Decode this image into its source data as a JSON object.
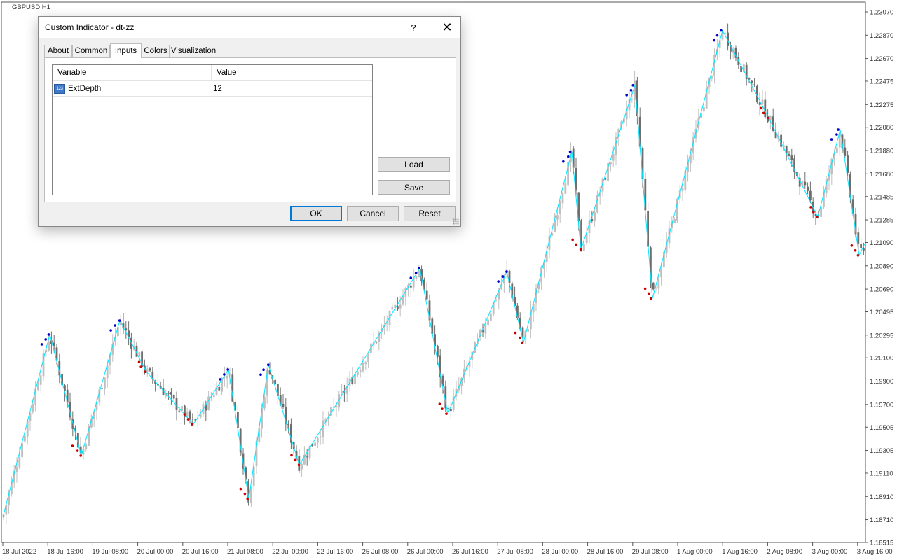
{
  "chart": {
    "symbol_label": "GBPUSD,H1",
    "price_labels": [
      "1.23070",
      "1.22870",
      "1.22670",
      "1.22475",
      "1.22275",
      "1.22080",
      "1.21880",
      "1.21680",
      "1.21485",
      "1.21285",
      "1.21090",
      "1.20890",
      "1.20690",
      "1.20495",
      "1.20295",
      "1.20100",
      "1.19900",
      "1.19700",
      "1.19505",
      "1.19305",
      "1.19110",
      "1.18910",
      "1.18710",
      "1.18515"
    ],
    "time_labels": [
      "18 Jul 2022",
      "18 Jul 16:00",
      "19 Jul 08:00",
      "20 Jul 00:00",
      "20 Jul 16:00",
      "21 Jul 08:00",
      "22 Jul 00:00",
      "22 Jul 16:00",
      "25 Jul 08:00",
      "26 Jul 00:00",
      "26 Jul 16:00",
      "27 Jul 08:00",
      "28 Jul 00:00",
      "28 Jul 16:00",
      "29 Jul 08:00",
      "1 Aug 00:00",
      "1 Aug 16:00",
      "2 Aug 08:00",
      "3 Aug 00:00",
      "3 Aug 16:00"
    ],
    "zigzag_color": "#00e5ff",
    "candle_up_color": "#c0c0c0",
    "candle_down_color": "#6e6e6e",
    "swing_high_color": "#0000cc",
    "swing_low_color": "#cc0000"
  },
  "dialog": {
    "title": "Custom Indicator - dt-zz",
    "help_label": "?",
    "close_label": "✕",
    "tabs": [
      {
        "label": "About"
      },
      {
        "label": "Common"
      },
      {
        "label": "Inputs"
      },
      {
        "label": "Colors"
      },
      {
        "label": "Visualization"
      }
    ],
    "active_tab": "Inputs",
    "grid": {
      "col_variable": "Variable",
      "col_value": "Value",
      "rows": [
        {
          "icon_text": "123",
          "variable": "ExtDepth",
          "value": "12"
        }
      ]
    },
    "load_label": "Load",
    "save_label": "Save",
    "ok_label": "OK",
    "cancel_label": "Cancel",
    "reset_label": "Reset"
  }
}
